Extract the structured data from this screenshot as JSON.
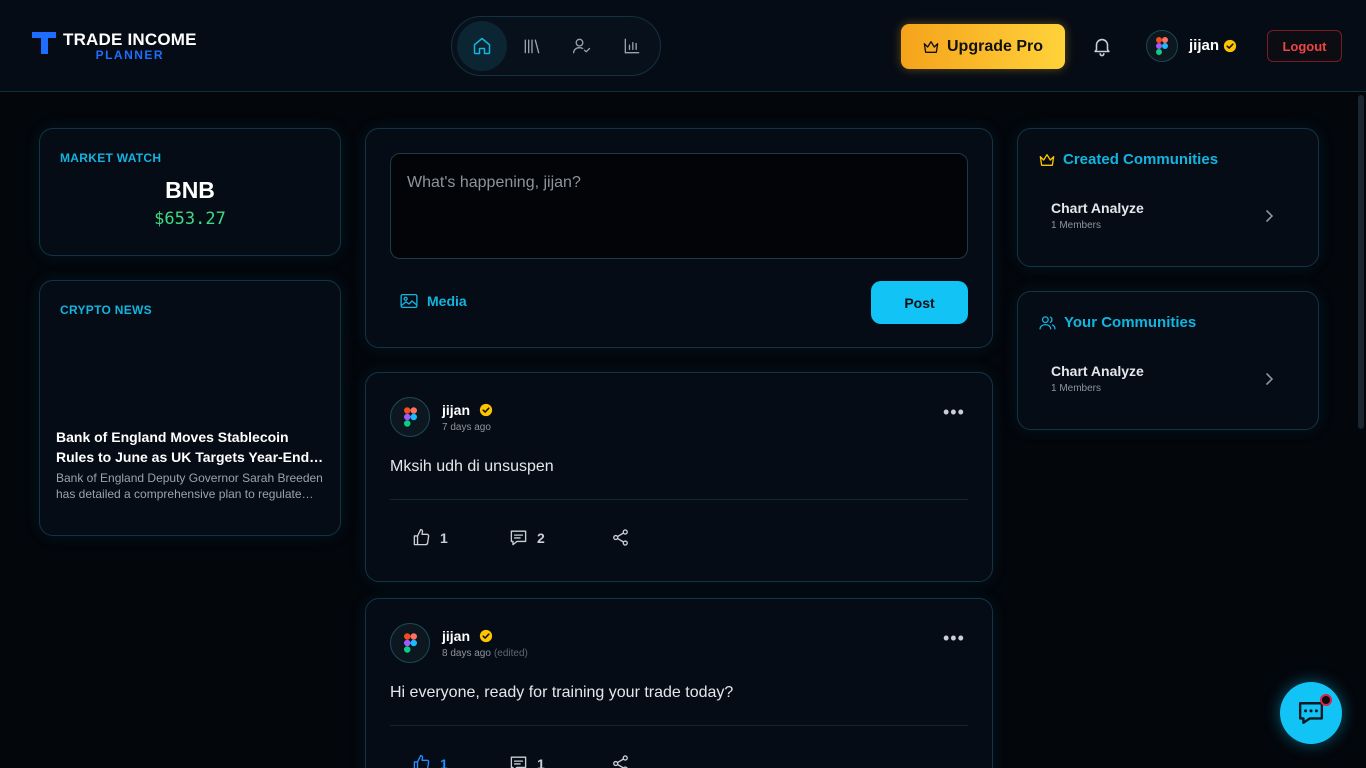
{
  "brand": {
    "line1": "TRADE INCOME",
    "line2": "PLANNER"
  },
  "nav": {
    "items": [
      "home-icon",
      "library-icon",
      "user-check-icon",
      "bar-chart-icon"
    ],
    "active": "home-icon"
  },
  "header": {
    "upgrade_label": "Upgrade Pro",
    "username": "jijan",
    "logout_label": "Logout"
  },
  "market_watch": {
    "label": "MARKET WATCH",
    "symbol": "BNB",
    "price": "$653.27"
  },
  "crypto_news": {
    "label": "CRYPTO NEWS",
    "headline": "Bank of England Moves Stablecoin Rules to June as UK Targets Year-End Launch",
    "summary": "Bank of England Deputy Governor Sarah Breeden has detailed a comprehensive plan to regulate stablecoins"
  },
  "composer": {
    "placeholder": "What's happening, jijan?",
    "media_label": "Media",
    "post_label": "Post"
  },
  "posts": [
    {
      "author": "jijan",
      "time": "7 days ago",
      "edited": "",
      "text": "Mksih udh di unsuspen",
      "likes": "1",
      "comments": "2"
    },
    {
      "author": "jijan",
      "time": "8 days ago",
      "edited": "(edited)",
      "text": "Hi everyone, ready for training your trade today?",
      "likes": "1",
      "comments": "1"
    }
  ],
  "created_communities": {
    "title": "Created Communities",
    "items": [
      {
        "name": "Chart Analyze",
        "members": "1 Members"
      }
    ]
  },
  "your_communities": {
    "title": "Your Communities",
    "items": [
      {
        "name": "Chart Analyze",
        "members": "1 Members"
      }
    ]
  },
  "colors": {
    "accent": "#12b4e0",
    "brand_blue": "#1e6dff",
    "price_green": "#3ddc84",
    "gold": "#ffc400",
    "danger": "#ef4444"
  }
}
